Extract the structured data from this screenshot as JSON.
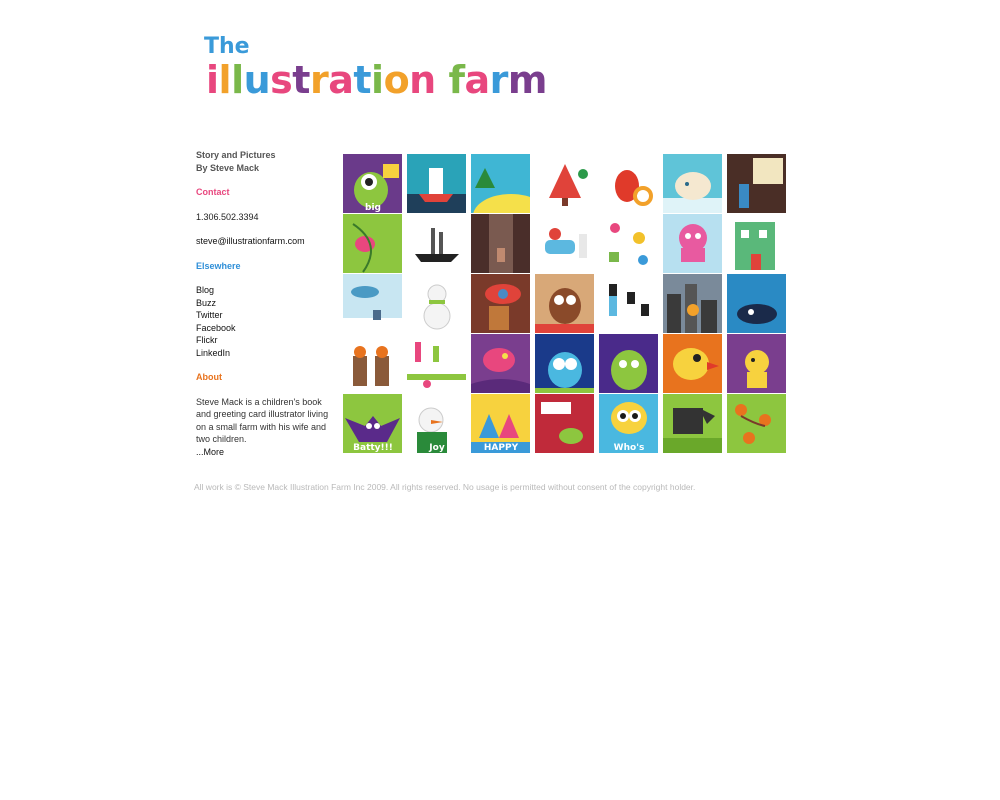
{
  "logo": {
    "the": "The",
    "letters": [
      {
        "ch": "i",
        "color": "#e8477e"
      },
      {
        "ch": "l",
        "color": "#f2a12a"
      },
      {
        "ch": "l",
        "color": "#7ab84a"
      },
      {
        "ch": "u",
        "color": "#3a9ad9"
      },
      {
        "ch": "s",
        "color": "#e8477e"
      },
      {
        "ch": "t",
        "color": "#7a3e8e"
      },
      {
        "ch": "r",
        "color": "#f2a12a"
      },
      {
        "ch": "a",
        "color": "#e8477e"
      },
      {
        "ch": "t",
        "color": "#3a9ad9"
      },
      {
        "ch": "i",
        "color": "#7ab84a"
      },
      {
        "ch": "o",
        "color": "#f2a12a"
      },
      {
        "ch": "n",
        "color": "#e8477e"
      },
      {
        "ch": " ",
        "color": "#ffffff"
      },
      {
        "ch": "f",
        "color": "#7ab84a"
      },
      {
        "ch": "a",
        "color": "#e8477e"
      },
      {
        "ch": "r",
        "color": "#3a9ad9"
      },
      {
        "ch": "m",
        "color": "#7a3e8e"
      }
    ]
  },
  "sidebar": {
    "tagline1": "Story and Pictures",
    "tagline2": "By Steve Mack",
    "contact_head": "Contact",
    "phone": "1.306.502.3394",
    "email": "steve@illustrationfarm.com",
    "elsewhere_head": "Elsewhere",
    "links": [
      "Blog",
      "Buzz",
      "Twitter",
      "Facebook",
      "Flickr",
      "LinkedIn"
    ],
    "about_head": "About",
    "about_text": "Steve Mack is a children's book and greeting card illustrator living on a small farm with his wife and two children.",
    "more": "...More"
  },
  "gallery": {
    "tiles": [
      {
        "bg": "#6a3a8a",
        "fg": "#8dc63f",
        "accent": "#f7d23e",
        "icon": "monster"
      },
      {
        "bg": "#2aa3b8",
        "fg": "#ffffff",
        "accent": "#1f3f5a",
        "icon": "boat"
      },
      {
        "bg": "#3fb6d4",
        "fg": "#f5e04a",
        "accent": "#2a8a3a",
        "icon": "hill"
      },
      {
        "bg": "#ffffff",
        "fg": "#e0433a",
        "accent": "#2c9a4a",
        "icon": "tree"
      },
      {
        "bg": "#ffffff",
        "fg": "#e03a2a",
        "accent": "#f2a12a",
        "icon": "lobster"
      },
      {
        "bg": "#5fc4d8",
        "fg": "#f5e8d0",
        "accent": "#2a6a8a",
        "icon": "bear"
      },
      {
        "bg": "#4a2e26",
        "fg": "#f2e6c0",
        "accent": "#3a8ac4",
        "icon": "sign"
      },
      {
        "bg": "#8dc63f",
        "fg": "#e8477e",
        "accent": "#3a7a2a",
        "icon": "bird"
      },
      {
        "bg": "#ffffff",
        "fg": "#555555",
        "accent": "#222222",
        "icon": "ship"
      },
      {
        "bg": "#4a2e2a",
        "fg": "#7a5a50",
        "accent": "#c08a70",
        "icon": "alley"
      },
      {
        "bg": "#ffffff",
        "fg": "#5cb8e0",
        "accent": "#e0433a",
        "icon": "bath"
      },
      {
        "bg": "#ffffff",
        "fg": "#e8477e",
        "accent": "#f2c12a",
        "icon": "items"
      },
      {
        "bg": "#b7e0f0",
        "fg": "#e85aa0",
        "accent": "#7a3e8e",
        "icon": "octopus"
      },
      {
        "bg": "#ffffff",
        "fg": "#5ab87a",
        "accent": "#e0433a",
        "icon": "house"
      },
      {
        "bg": "#c8e6f2",
        "fg": "#4a9ac4",
        "accent": "#ffffff",
        "icon": "stork"
      },
      {
        "bg": "#ffffff",
        "fg": "#8dc63f",
        "accent": "#e8731e",
        "icon": "snowman"
      },
      {
        "bg": "#7a3a2a",
        "fg": "#e0433a",
        "accent": "#4a8ac4",
        "icon": "car"
      },
      {
        "bg": "#d8a878",
        "fg": "#8a4a2a",
        "accent": "#e0433a",
        "icon": "owl"
      },
      {
        "bg": "#ffffff",
        "fg": "#5cb8e0",
        "accent": "#222222",
        "icon": "hats"
      },
      {
        "bg": "#7a8a9a",
        "fg": "#3a3a3a",
        "accent": "#f2a12a",
        "icon": "city"
      },
      {
        "bg": "#2a8ac4",
        "fg": "#1a2a4a",
        "accent": "#ffffff",
        "icon": "whale"
      },
      {
        "bg": "#ffffff",
        "fg": "#8a5a3a",
        "accent": "#e8731e",
        "icon": "kids"
      },
      {
        "bg": "#ffffff",
        "fg": "#e8477e",
        "accent": "#8dc63f",
        "icon": "party"
      },
      {
        "bg": "#7a3e8e",
        "fg": "#e8477e",
        "accent": "#f5e04a",
        "icon": "birdpurple"
      },
      {
        "bg": "#1a3a8a",
        "fg": "#4ab8e0",
        "accent": "#8dc63f",
        "icon": "owlblue"
      },
      {
        "bg": "#4a2a8a",
        "fg": "#8dc63f",
        "accent": "#f7d23e",
        "icon": "pear"
      },
      {
        "bg": "#e8731e",
        "fg": "#f7d23e",
        "accent": "#e03a2a",
        "icon": "birdorange"
      },
      {
        "bg": "#7a3e8e",
        "fg": "#f7d23e",
        "accent": "#e0433a",
        "icon": "dog"
      },
      {
        "bg": "#8dc63f",
        "fg": "#5a2a8a",
        "accent": "#ffffff",
        "icon": "bat"
      },
      {
        "bg": "#ffffff",
        "fg": "#2a8a3a",
        "accent": "#e8731e",
        "icon": "snowmanjoy"
      },
      {
        "bg": "#f7d23e",
        "fg": "#3a9ad9",
        "accent": "#e8477e",
        "icon": "happy"
      },
      {
        "bg": "#c02a3a",
        "fg": "#ffffff",
        "accent": "#8dc63f",
        "icon": "turtle"
      },
      {
        "bg": "#4ab8e0",
        "fg": "#1a1a1a",
        "accent": "#f7d23e",
        "icon": "whos"
      },
      {
        "bg": "#8dc63f",
        "fg": "#333333",
        "accent": "#ffffff",
        "icon": "horse"
      },
      {
        "bg": "#8dc63f",
        "fg": "#e8731e",
        "accent": "#7a3a2a",
        "icon": "monkeys"
      }
    ],
    "tile_text": {
      "0": "big",
      "22": "",
      "27": "",
      "28": "Batty!!!",
      "29": "Joy",
      "30": "HAPPY",
      "32": "Who's"
    }
  },
  "footer": "All work is © Steve Mack Illustration Farm Inc 2009. All rights reserved. No usage is permitted without consent of the copyright holder."
}
